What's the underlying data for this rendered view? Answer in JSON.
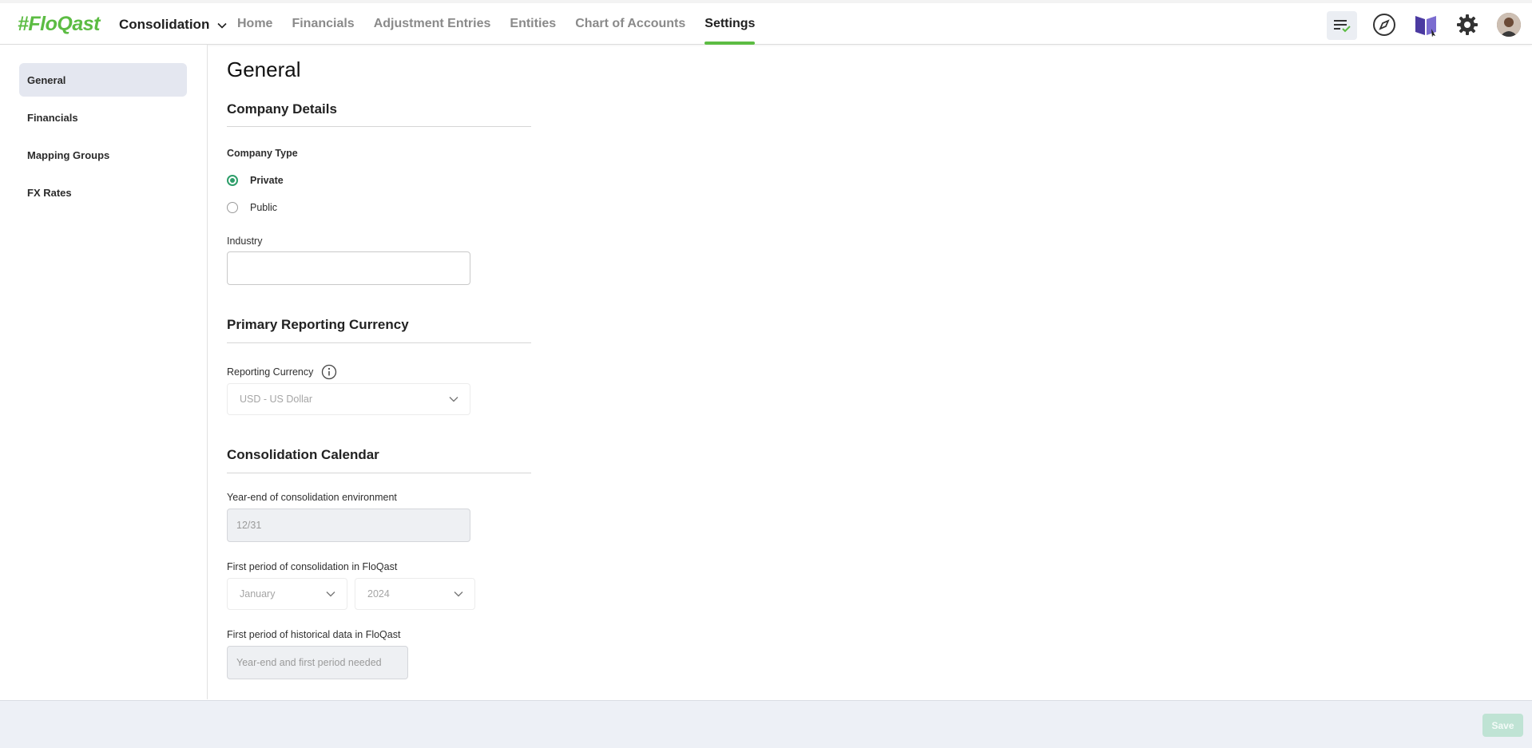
{
  "header": {
    "logo": "#FloQast",
    "product_switcher": "Consolidation",
    "nav": [
      {
        "label": "Home"
      },
      {
        "label": "Financials"
      },
      {
        "label": "Adjustment Entries"
      },
      {
        "label": "Entities"
      },
      {
        "label": "Chart of Accounts"
      },
      {
        "label": "Settings",
        "active": true
      }
    ],
    "icons": [
      "tasks-icon",
      "compass-icon",
      "book-icon",
      "gear-icon",
      "avatar"
    ]
  },
  "sidebar": {
    "items": [
      {
        "label": "General",
        "active": true
      },
      {
        "label": "Financials"
      },
      {
        "label": "Mapping Groups"
      },
      {
        "label": "FX Rates"
      }
    ]
  },
  "main": {
    "title": "General",
    "company_details": {
      "heading": "Company Details",
      "company_type_label": "Company Type",
      "options": [
        {
          "label": "Private",
          "checked": true
        },
        {
          "label": "Public",
          "checked": false
        }
      ],
      "industry_label": "Industry",
      "industry_value": ""
    },
    "primary_reporting_currency": {
      "heading": "Primary Reporting Currency",
      "label": "Reporting Currency",
      "value": "USD - US Dollar"
    },
    "consolidation_calendar": {
      "heading": "Consolidation Calendar",
      "year_end_label": "Year-end of consolidation environment",
      "year_end_placeholder": "12/31",
      "first_period_label": "First period of consolidation in FloQast",
      "first_period_month": "January",
      "first_period_year": "2024",
      "historical_label": "First period of historical data in FloQast",
      "historical_placeholder": "Year-end and first period needed"
    }
  },
  "footer": {
    "save_label": "Save"
  },
  "colors": {
    "brand_green": "#5cbc43",
    "radio_green": "#2e9e6a",
    "active_sidebar_bg": "#e4e7f0",
    "save_disabled": "#bfe3d4"
  }
}
